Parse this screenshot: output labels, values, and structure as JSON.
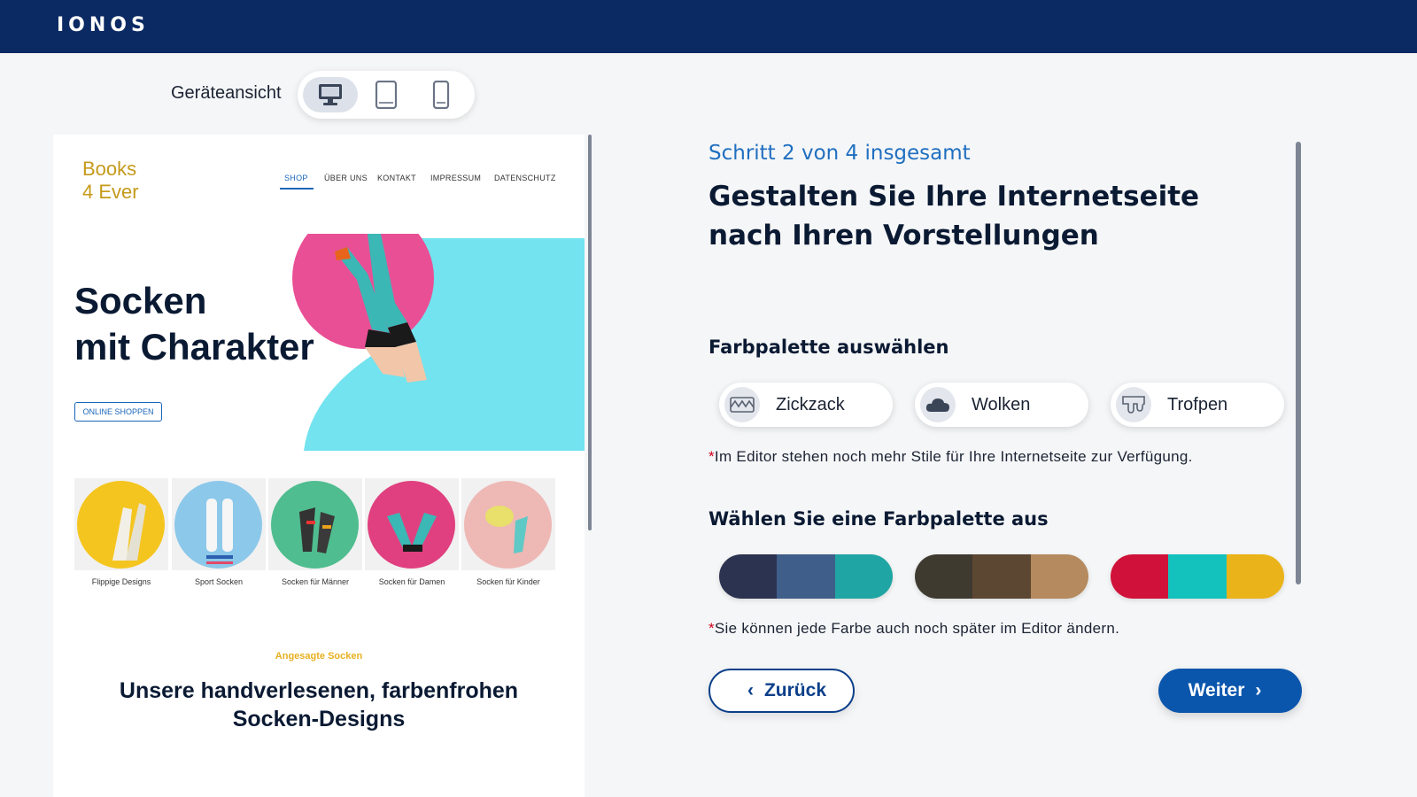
{
  "header": {
    "logo": "IONOS"
  },
  "device_view": {
    "label": "Geräteansicht",
    "options": [
      {
        "icon": "desktop-icon",
        "active": true
      },
      {
        "icon": "tablet-icon",
        "active": false
      },
      {
        "icon": "phone-icon",
        "active": false
      }
    ]
  },
  "preview": {
    "logo_line1": "Books",
    "logo_line2": "4 Ever",
    "nav": [
      "SHOP",
      "ÜBER UNS",
      "KONTAKT",
      "IMPRESSUM",
      "DATENSCHUTZ"
    ],
    "hero_line1": "Socken",
    "hero_line2": "mit Charakter",
    "hero_button": "ONLINE SHOPPEN",
    "categories": [
      "Flippige Designs",
      "Sport Socken",
      "Socken für Männer",
      "Socken für Damen",
      "Socken für Kinder"
    ],
    "trending_label": "Angesagte Socken",
    "bottom_line1": "Unsere handverlesenen, farbenfrohen",
    "bottom_line2": "Socken-Designs"
  },
  "panel": {
    "step": "Schritt 2 von 4 insgesamt",
    "title_line1": "Gestalten Sie Ihre Internetseite",
    "title_line2": "nach Ihren Vorstellungen",
    "style_section_title": "Farbpalette auswählen",
    "styles": [
      {
        "label": "Zickzack",
        "icon": "zigzag-icon"
      },
      {
        "label": "Wolken",
        "icon": "cloud-icon"
      },
      {
        "label": "Trofpen",
        "icon": "drops-icon"
      }
    ],
    "style_note_star": "*",
    "style_note": "Im Editor stehen noch mehr Stile für Ihre Internetseite zur Verfügung.",
    "palette_section_title": "Wählen Sie eine Farbpalette aus",
    "palettes": [
      [
        "#2b3350",
        "#3f5f8a",
        "#1fa5a3"
      ],
      [
        "#3f3a30",
        "#5c4733",
        "#b58a5f"
      ],
      [
        "#d0123a",
        "#13c2bd",
        "#eab31a"
      ]
    ],
    "palette_note_star": "*",
    "palette_note": "Sie können jede Farbe auch noch später im Editor ändern.",
    "back_label": "Zurück",
    "next_label": "Weiter"
  },
  "colors": {
    "header_bg": "#0b2a63",
    "accent_blue": "#1f6fc1",
    "primary_button": "#0b56ad"
  }
}
